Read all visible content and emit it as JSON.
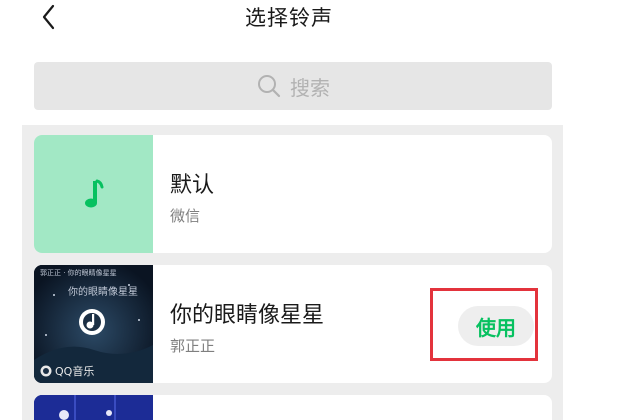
{
  "header": {
    "title": "选择铃声"
  },
  "search": {
    "placeholder": "搜索"
  },
  "ringtones": [
    {
      "title": "默认",
      "artist": "微信"
    },
    {
      "title": "你的眼睛像星星",
      "artist": "郭正正",
      "use_label": "使用",
      "album_caption": "QQ音乐",
      "album_top_text": "你的眼睛像星星",
      "album_small_text": "郭正正 · 你的眼睛像星星"
    }
  ],
  "colors": {
    "accent_green": "#07c160",
    "default_thumb_bg": "#a2e8c5",
    "highlight_red": "#e3333c",
    "panel_bg": "#ededed"
  }
}
